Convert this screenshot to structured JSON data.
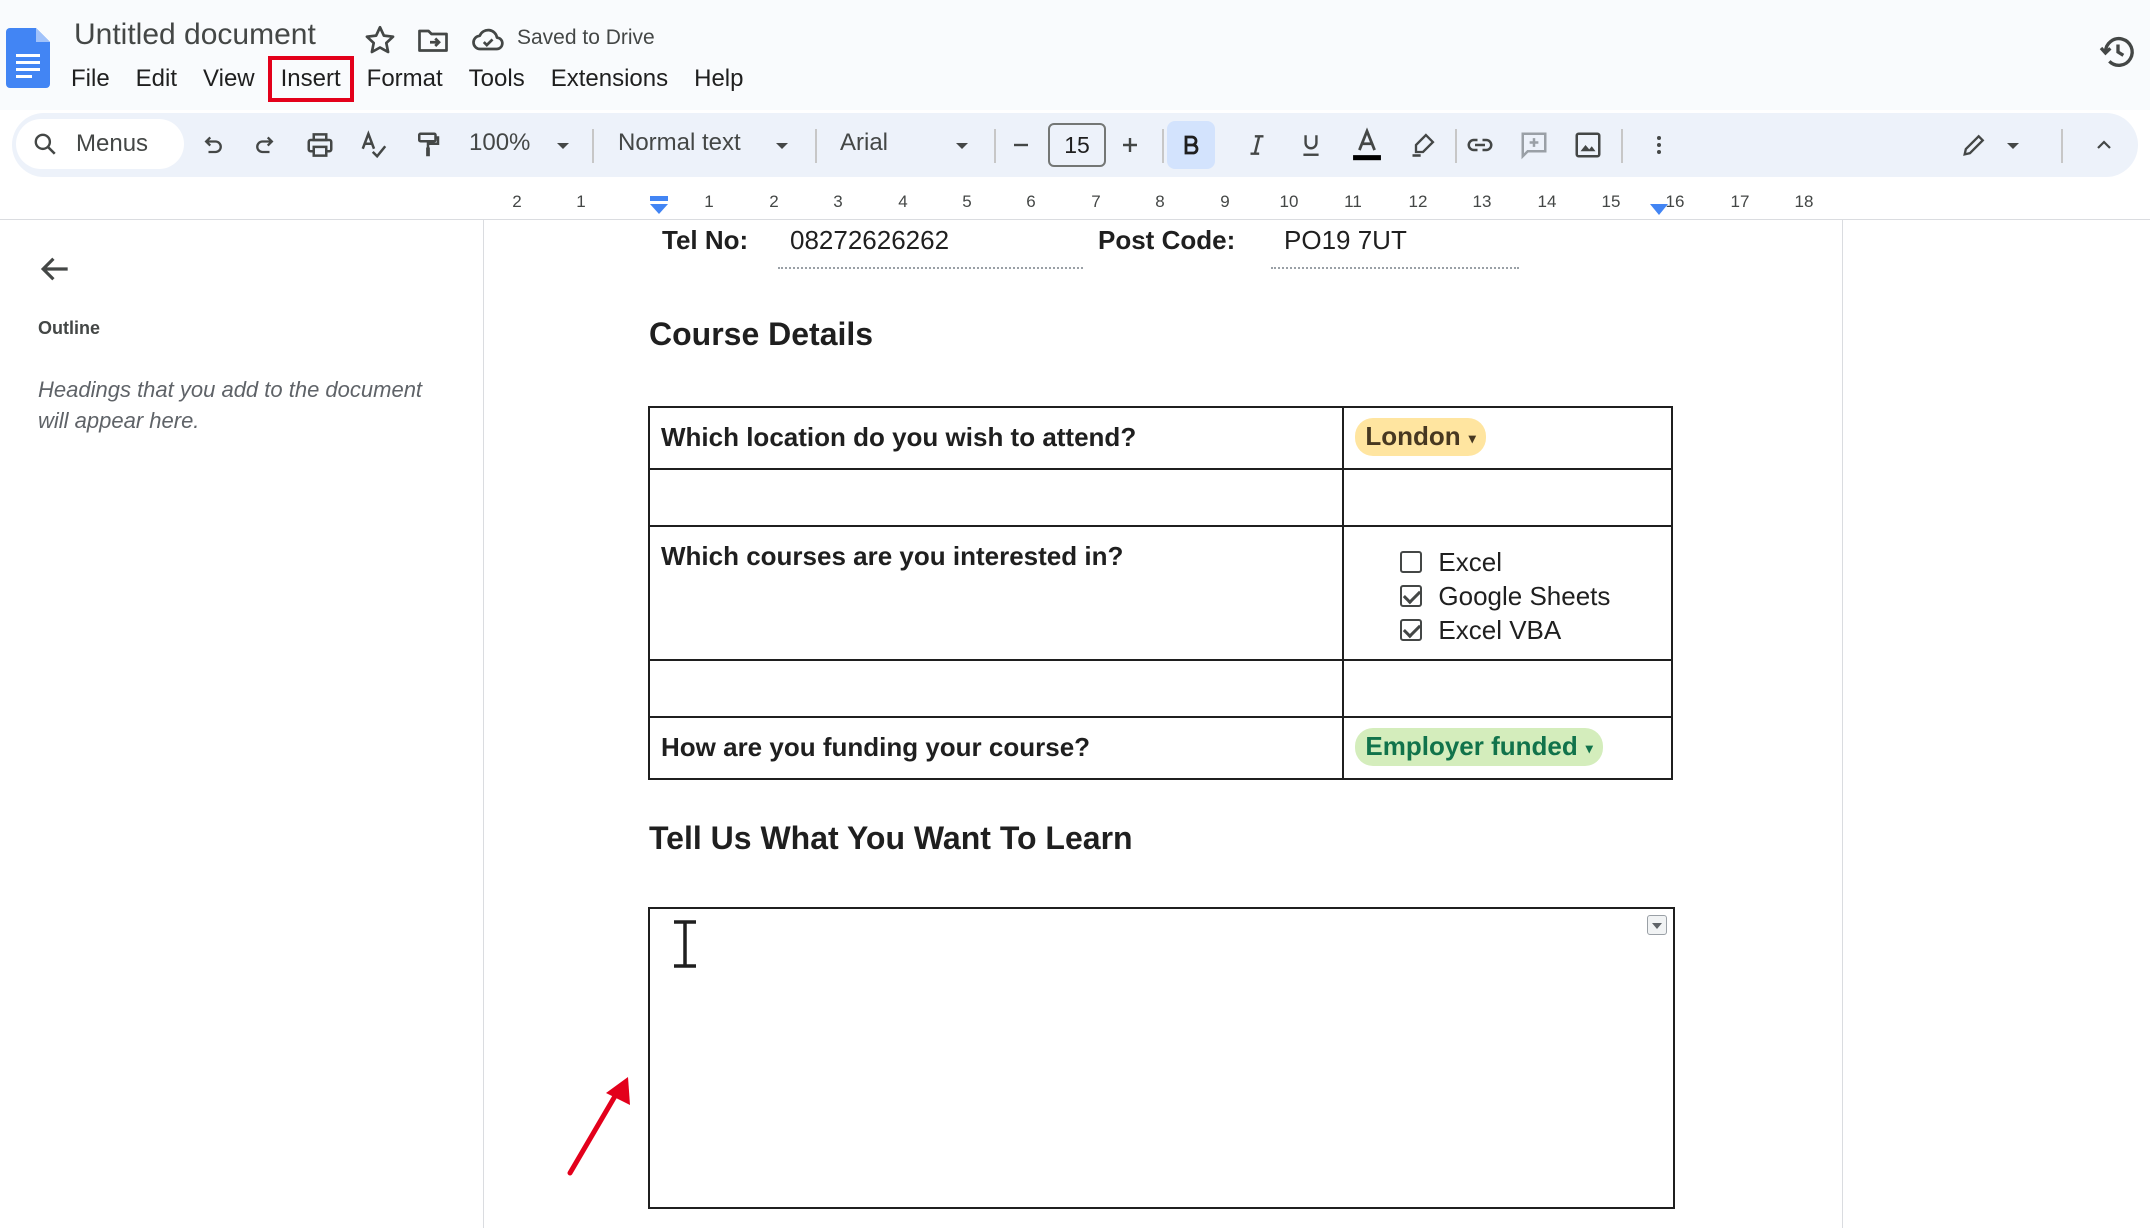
{
  "app": {
    "document_title": "Untitled document",
    "save_status": "Saved to Drive"
  },
  "menubar": {
    "items": [
      "File",
      "Edit",
      "View",
      "Insert",
      "Format",
      "Tools",
      "Extensions",
      "Help"
    ],
    "highlighted": "Insert"
  },
  "toolbar": {
    "search_label": "Menus",
    "zoom": "100%",
    "paragraph_style": "Normal text",
    "font": "Arial",
    "font_size": "15",
    "bold_active": true
  },
  "ruler": {
    "labels": [
      "2",
      "1",
      "1",
      "2",
      "3",
      "4",
      "5",
      "6",
      "7",
      "8",
      "9",
      "10",
      "11",
      "12",
      "13",
      "14",
      "15",
      "16",
      "17",
      "18"
    ]
  },
  "outline": {
    "label": "Outline",
    "hint": "Headings that you add to the document will appear here."
  },
  "document": {
    "tel_label": "Tel No:",
    "tel_value": "08272626262",
    "postcode_label": "Post Code:",
    "postcode_value": "PO19 7UT",
    "course_heading": "Course Details",
    "location_question": "Which location do you wish to attend?",
    "location_value": "London",
    "courses_question": "Which courses are you interested in?",
    "courses": [
      {
        "label": "Excel",
        "checked": false
      },
      {
        "label": "Google Sheets",
        "checked": true
      },
      {
        "label": "Excel VBA",
        "checked": true
      }
    ],
    "funding_question": "How are you funding your course?",
    "funding_value": "Employer funded",
    "learn_heading": "Tell Us What You Want To Learn"
  },
  "colors": {
    "highlight_box": "#e3001b",
    "annotation_arrow": "#e3001b",
    "chip_london_bg": "#ffe5a0",
    "chip_employer_bg": "#d4edbc",
    "chip_employer_text": "#11734b",
    "toolbar_bg": "#edf2fa",
    "docs_blue": "#4285f4"
  },
  "icons": [
    "docs-logo-icon",
    "star-icon",
    "move-folder-icon",
    "cloud-saved-icon",
    "history-icon",
    "search-icon",
    "undo-icon",
    "redo-icon",
    "print-icon",
    "spellcheck-icon",
    "paint-format-icon",
    "bold-icon",
    "italic-icon",
    "underline-icon",
    "text-color-icon",
    "highlight-pen-icon",
    "link-icon",
    "add-comment-icon",
    "insert-image-icon",
    "more-vert-icon",
    "editing-mode-pencil-icon",
    "collapse-chevron-icon",
    "back-arrow-icon",
    "text-cursor-icon",
    "red-annotation-arrow-icon"
  ]
}
